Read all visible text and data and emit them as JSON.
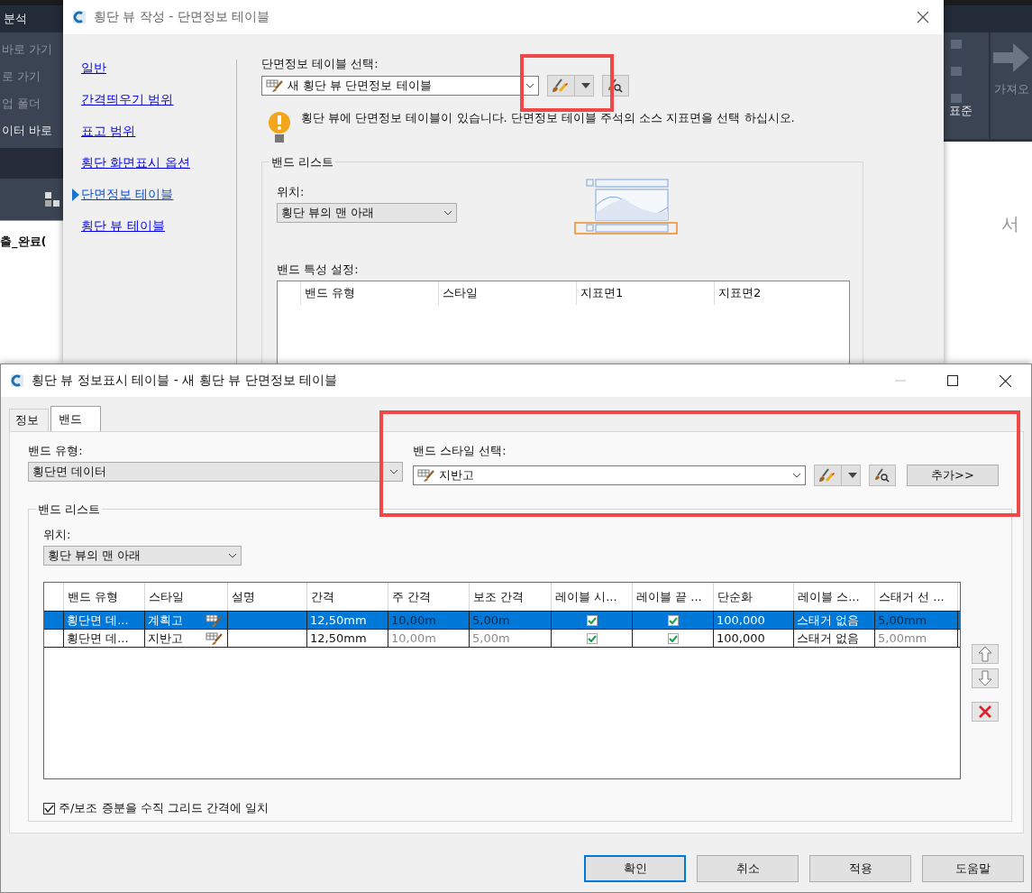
{
  "background_app": {
    "menu": [
      "분석"
    ],
    "panel_items": [
      "바로 가기",
      "로 가기",
      "업 폴더",
      "이터 바로"
    ],
    "file_label": "출_완료(",
    "ribbon_button": "가져오",
    "ribbon_style": "표준",
    "viewcube_label": "서"
  },
  "dialog_1": {
    "title": "횡단 뷰 작성 - 단면정보 테이블",
    "nav": [
      {
        "label": "일반",
        "selected": false
      },
      {
        "label": "간격띄우기 범위",
        "selected": false
      },
      {
        "label": "표고 범위",
        "selected": false
      },
      {
        "label": "횡단 화면표시 옵션",
        "selected": false
      },
      {
        "label": "단면정보 테이블",
        "selected": true
      },
      {
        "label": "횡단 뷰 테이블",
        "selected": false
      }
    ],
    "table_select_label": "단면정보 테이블 선택:",
    "table_select_value": "새 횡단 뷰 단면정보 테이블",
    "warning": "횡단 뷰에 단면정보 테이블이 있습니다. 단면정보 테이블 주석의 소스 지표면을 선택 하십시오.",
    "band_list": {
      "title": "밴드 리스트",
      "position_label": "위치:",
      "position_value": "횡단 뷰의 맨 아래"
    },
    "band_settings_label": "밴드 특성 설정:",
    "band_settings_columns": [
      "밴드 유형",
      "스타일",
      "지표면1",
      "지표면2"
    ]
  },
  "dialog_2": {
    "title": "횡단 뷰 정보표시 테이블 - 새 횡단 뷰 단면정보 테이블",
    "tabs": [
      {
        "label": "정보",
        "selected": false
      },
      {
        "label": "밴드",
        "selected": true
      }
    ],
    "band_type_label": "밴드 유형:",
    "band_type_value": "횡단면 데이터",
    "band_style_label": "밴드 스타일 선택:",
    "band_style_value": "지반고",
    "add_button": "추가>>",
    "band_list": {
      "title": "밴드 리스트",
      "position_label": "위치:",
      "position_value": "횡단 뷰의 맨 아래",
      "columns": [
        "밴드 유형",
        "스타일",
        "설명",
        "간격",
        "주 간격",
        "보조 간격",
        "레이블 시...",
        "레이블 끝 ...",
        "단순화",
        "레이블 스...",
        "스태거 선 ..."
      ],
      "rows": [
        {
          "selected": true,
          "cells": [
            {
              "kind": "text",
              "text": "횡단면 데...",
              "dim": false
            },
            {
              "kind": "style",
              "text": "계획고"
            },
            {
              "kind": "empty"
            },
            {
              "kind": "text",
              "text": "12,50mm",
              "dim": false
            },
            {
              "kind": "text",
              "text": "10,00m",
              "dim": true
            },
            {
              "kind": "text",
              "text": "5,00m",
              "dim": true
            },
            {
              "kind": "check",
              "checked": true
            },
            {
              "kind": "check",
              "checked": true
            },
            {
              "kind": "text",
              "text": "100,000",
              "dim": false
            },
            {
              "kind": "text",
              "text": "스태거 없음",
              "dim": false
            },
            {
              "kind": "text",
              "text": "5,00mm",
              "dim": true
            }
          ]
        },
        {
          "selected": false,
          "cells": [
            {
              "kind": "text",
              "text": "횡단면 데...",
              "dim": false
            },
            {
              "kind": "style",
              "text": "지반고"
            },
            {
              "kind": "empty"
            },
            {
              "kind": "text",
              "text": "12,50mm",
              "dim": false
            },
            {
              "kind": "text",
              "text": "10,00m",
              "dim": true
            },
            {
              "kind": "text",
              "text": "5,00m",
              "dim": true
            },
            {
              "kind": "check",
              "checked": true
            },
            {
              "kind": "check",
              "checked": true
            },
            {
              "kind": "text",
              "text": "100,000",
              "dim": false
            },
            {
              "kind": "text",
              "text": "스태거 없음",
              "dim": false
            },
            {
              "kind": "text",
              "text": "5,00mm",
              "dim": true
            }
          ]
        }
      ],
      "match_grid": {
        "label": "주/보조 증분을 수직 그리드 간격에 일치",
        "checked": true
      }
    },
    "buttons": [
      {
        "label": "확인",
        "default": true
      },
      {
        "label": "취소",
        "default": false
      },
      {
        "label": "적용",
        "default": false
      },
      {
        "label": "도움말",
        "default": false
      }
    ]
  }
}
